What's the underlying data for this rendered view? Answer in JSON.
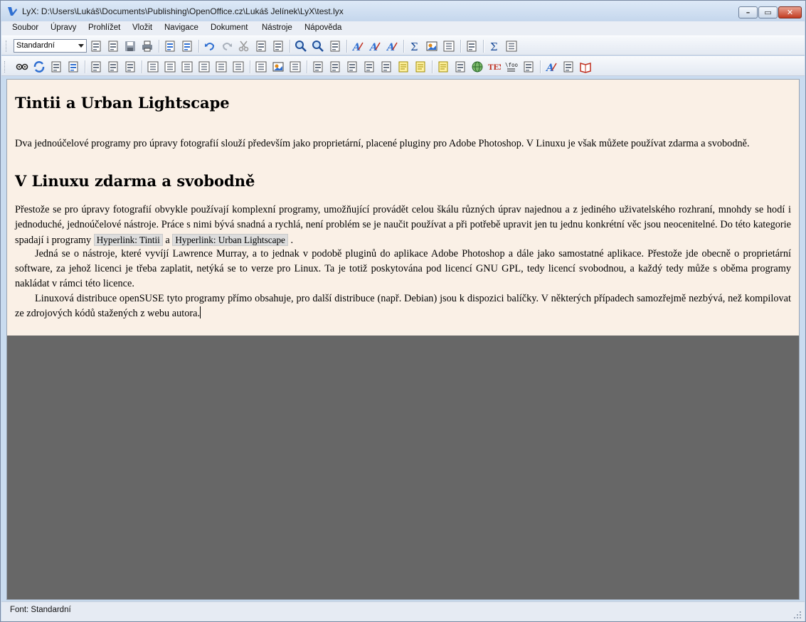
{
  "window": {
    "title": "LyX: D:\\Users\\Lukáš\\Documents\\Publishing\\OpenOffice.cz\\Lukáš Jelínek\\LyX\\test.lyx",
    "minimize": "–",
    "maximize": "▭",
    "close": "✕"
  },
  "menu": {
    "items": [
      "Soubor",
      "Úpravy",
      "Prohlížet",
      "Vložit",
      "Navigace",
      "Dokument",
      "Nástroje",
      "Nápověda"
    ]
  },
  "toolbar": {
    "layout_combo_value": "Standardní",
    "row1_icons": [
      "new-document-icon",
      "open-icon",
      "save-icon",
      "print-icon",
      "spellcheck-icon",
      "thesaurus-icon",
      "undo-icon",
      "redo-icon",
      "cut-icon",
      "copy-icon",
      "paste-icon",
      "find-icon",
      "find-replace-icon",
      "navigate-back-icon",
      "emphasis-icon",
      "noun-icon",
      "text-style-icon",
      "math-icon",
      "figure-icon",
      "table-icon",
      "view-icon",
      "math-panel-icon",
      "table-panel-icon"
    ],
    "row2_icons": [
      "view-pdf-icon",
      "update-icon",
      "view-master-icon",
      "update-master-icon",
      "dvi-icon",
      "view-changes-icon",
      "track-changes-icon",
      "align-left-icon",
      "numbered-list-icon",
      "bullet-list-icon",
      "description-list-icon",
      "list-icon",
      "decrease-depth-icon",
      "increase-depth-icon",
      "insert-graphics-icon",
      "insert-table-icon",
      "label-icon",
      "cross-reference-icon",
      "citation-icon",
      "index-entry-icon",
      "nomenclature-icon",
      "footnote-icon",
      "margin-note-icon",
      "note-icon",
      "box-icon",
      "url-icon",
      "tex-code-icon",
      "foo-icon",
      "attachment-icon",
      "character-style-icon",
      "paragraph-settings-icon",
      "book-icon"
    ],
    "tex_label": "TEX",
    "foo_label": "\\foo"
  },
  "document": {
    "heading1": "Tintii a Urban Lightscape",
    "para1": "Dva jednoúčelové programy pro úpravy fotografií slouží především jako proprietární, placené pluginy pro Adobe Photoshop. V Linuxu je však můžete používat zdarma a svobodně.",
    "heading2": "V Linuxu zdarma a svobodně",
    "para2_text": "Přestože se pro úpravy fotografií obvykle používají komplexní programy, umožňující provádět celou škálu různých úprav najednou a z jediného uživatelského rozhraní, mnohdy se hodí i jednoduché, jednoúčelové nástroje. Práce s nimi bývá snadná a rychlá, není problém se je naučit používat a při potřebě upravit jen tu jednu konkrétní věc jsou neocenitelné. Do této kategorie spadají i programy",
    "hyperlink1": "Hyperlink: Tintii",
    "and_word": "a",
    "hyperlink2": "Hyperlink: Urban Lightscape",
    "para2_end": ".",
    "para3": "Jedná se o nástroje, které vyvíjí Lawrence Murray, a to jednak v podobě pluginů do aplikace Adobe Photoshop a dále jako samostatné aplikace. Přestože jde obecně o proprietární software, za jehož licenci je třeba zaplatit, netýká se to verze pro Linux. Ta je totiž poskytována pod licencí GNU GPL, tedy licencí svobodnou, a každý tedy může s oběma programy nakládat v rámci této licence.",
    "para4": "Linuxová distribuce openSUSE tyto programy přímo obsahuje, pro další distribuce (např. Debian) jsou k dispozici balíčky. V některých případech samozřejmě nezbývá, než kompilovat ze zdrojových kódů stažených z webu autora."
  },
  "status": {
    "text": "Font: Standardní"
  }
}
